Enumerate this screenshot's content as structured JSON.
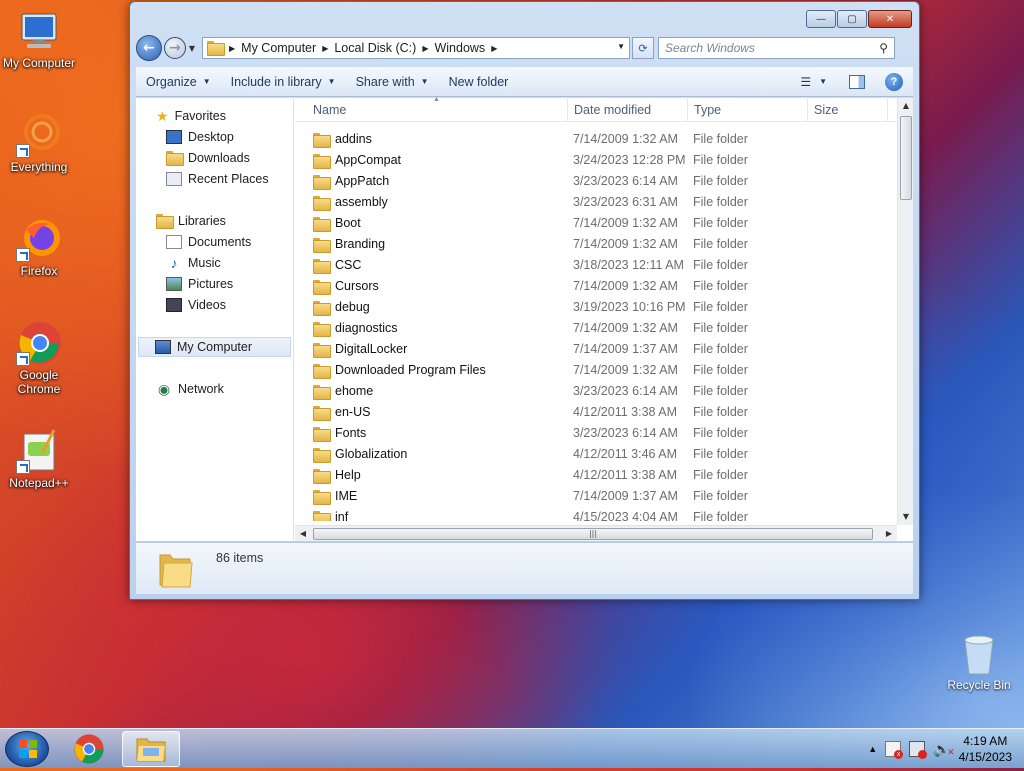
{
  "desktop": {
    "icons": [
      {
        "label": "My Computer"
      },
      {
        "label": "Everything"
      },
      {
        "label": "Firefox"
      },
      {
        "label": "Google Chrome"
      },
      {
        "label": "Notepad++"
      },
      {
        "label": "Recycle Bin"
      }
    ]
  },
  "window": {
    "title_buttons": {
      "minimize": "—",
      "maximize": "▢",
      "close": "✕"
    },
    "breadcrumb": [
      "My Computer",
      "Local Disk (C:)",
      "Windows"
    ],
    "search_placeholder": "Search Windows",
    "toolbar": {
      "organize": "Organize",
      "include_in_library": "Include in library",
      "share_with": "Share with",
      "new_folder": "New folder"
    },
    "nav_pane": {
      "favorites": "Favorites",
      "favorites_items": [
        "Desktop",
        "Downloads",
        "Recent Places"
      ],
      "libraries": "Libraries",
      "libraries_items": [
        "Documents",
        "Music",
        "Pictures",
        "Videos"
      ],
      "computer": "My Computer",
      "network": "Network"
    },
    "columns": {
      "name": "Name",
      "date_modified": "Date modified",
      "type": "Type",
      "size": "Size"
    },
    "files": [
      {
        "name": "addins",
        "date": "7/14/2009 1:32 AM",
        "type": "File folder"
      },
      {
        "name": "AppCompat",
        "date": "3/24/2023 12:28 PM",
        "type": "File folder"
      },
      {
        "name": "AppPatch",
        "date": "3/23/2023 6:14 AM",
        "type": "File folder"
      },
      {
        "name": "assembly",
        "date": "3/23/2023 6:31 AM",
        "type": "File folder"
      },
      {
        "name": "Boot",
        "date": "7/14/2009 1:32 AM",
        "type": "File folder"
      },
      {
        "name": "Branding",
        "date": "7/14/2009 1:32 AM",
        "type": "File folder"
      },
      {
        "name": "CSC",
        "date": "3/18/2023 12:11 AM",
        "type": "File folder"
      },
      {
        "name": "Cursors",
        "date": "7/14/2009 1:32 AM",
        "type": "File folder"
      },
      {
        "name": "debug",
        "date": "3/19/2023 10:16 PM",
        "type": "File folder"
      },
      {
        "name": "diagnostics",
        "date": "7/14/2009 1:32 AM",
        "type": "File folder"
      },
      {
        "name": "DigitalLocker",
        "date": "7/14/2009 1:37 AM",
        "type": "File folder"
      },
      {
        "name": "Downloaded Program Files",
        "date": "7/14/2009 1:32 AM",
        "type": "File folder"
      },
      {
        "name": "ehome",
        "date": "3/23/2023 6:14 AM",
        "type": "File folder"
      },
      {
        "name": "en-US",
        "date": "4/12/2011 3:38 AM",
        "type": "File folder"
      },
      {
        "name": "Fonts",
        "date": "3/23/2023 6:14 AM",
        "type": "File folder"
      },
      {
        "name": "Globalization",
        "date": "4/12/2011 3:46 AM",
        "type": "File folder"
      },
      {
        "name": "Help",
        "date": "4/12/2011 3:38 AM",
        "type": "File folder"
      },
      {
        "name": "IME",
        "date": "7/14/2009 1:37 AM",
        "type": "File folder"
      },
      {
        "name": "inf",
        "date": "4/15/2023 4:04 AM",
        "type": "File folder"
      }
    ],
    "status": {
      "item_count": "86 items"
    }
  },
  "taskbar": {
    "clock_time": "4:19 AM",
    "clock_date": "4/15/2023",
    "tray_expand": "▲"
  }
}
